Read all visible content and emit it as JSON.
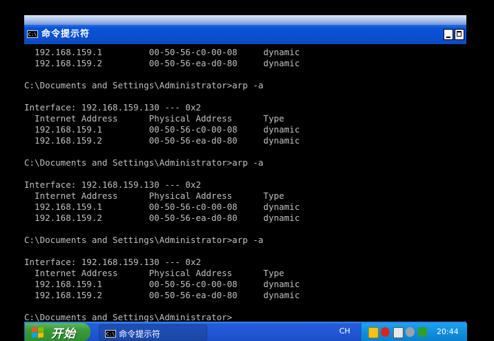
{
  "window": {
    "title": "命令提示符",
    "icon_label": "C:\\",
    "minimize_icon": "minimize-icon",
    "maximize_icon": "maximize-icon"
  },
  "console": {
    "lines": [
      "  192.168.159.1         00-50-56-c0-00-08     dynamic",
      "  192.168.159.2         00-50-56-ea-d0-80     dynamic",
      "",
      "C:\\Documents and Settings\\Administrator>arp -a",
      "",
      "Interface: 192.168.159.130 --- 0x2",
      "  Internet Address      Physical Address      Type",
      "  192.168.159.1         00-50-56-c0-00-08     dynamic",
      "  192.168.159.2         00-50-56-ea-d0-80     dynamic",
      "",
      "C:\\Documents and Settings\\Administrator>arp -a",
      "",
      "Interface: 192.168.159.130 --- 0x2",
      "  Internet Address      Physical Address      Type",
      "  192.168.159.1         00-50-56-c0-00-08     dynamic",
      "  192.168.159.2         00-50-56-ea-d0-80     dynamic",
      "",
      "C:\\Documents and Settings\\Administrator>arp -a",
      "",
      "Interface: 192.168.159.130 --- 0x2",
      "  Internet Address      Physical Address      Type",
      "  192.168.159.1         00-50-56-c0-00-08     dynamic",
      "  192.168.159.2         00-50-56-ea-d0-80     dynamic",
      "",
      "C:\\Documents and Settings\\Administrator>"
    ]
  },
  "taskbar": {
    "start_label": "开始",
    "task_button_label": "命令提示符",
    "task_icon_label": "C:\\",
    "language": "CH",
    "clock": "20:44",
    "tray_icons": [
      "shield-icon",
      "security-alert-icon",
      "vmware-icon",
      "network-icon",
      "update-icon"
    ]
  },
  "colors": {
    "title_bar": "#0b55d6",
    "console_bg": "#000000",
    "console_text": "#c0c0c0",
    "taskbar": "#245edb",
    "start_button": "#3a9a3a",
    "tray": "#108fde"
  }
}
